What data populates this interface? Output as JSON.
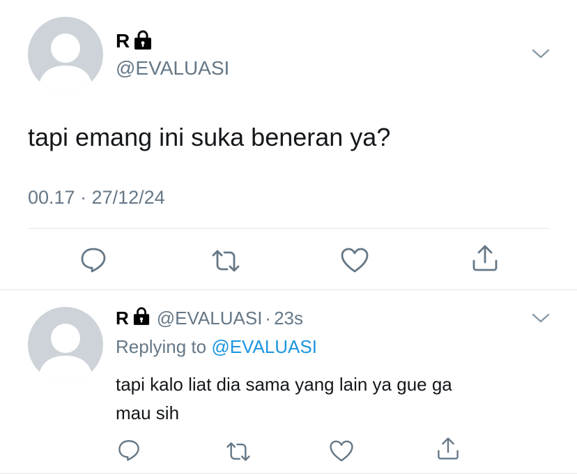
{
  "main_tweet": {
    "display_name": "R",
    "handle": "@EVALUASI",
    "text": "tapi emang ini suka beneran ya?",
    "timestamp": "00.17 · 27/12/24",
    "actions": [
      "reply-icon",
      "retweet-icon",
      "like-icon",
      "share-icon"
    ]
  },
  "reply_tweet": {
    "display_name": "R",
    "handle": "@EVALUASI",
    "separator": "·",
    "age": "23s",
    "replying_prefix": "Replying to",
    "replying_handle": "@EVALUASI",
    "text_line1": "tapi kalo liat dia sama yang lain ya gue ga",
    "text_line2": "mau sih",
    "actions": [
      "reply-icon",
      "retweet-icon",
      "like-icon",
      "share-icon"
    ]
  },
  "colors": {
    "muted": "#657786",
    "link": "#1b95e0",
    "avatar_bg": "#cdd3d8",
    "divider": "#e1e8ed"
  }
}
